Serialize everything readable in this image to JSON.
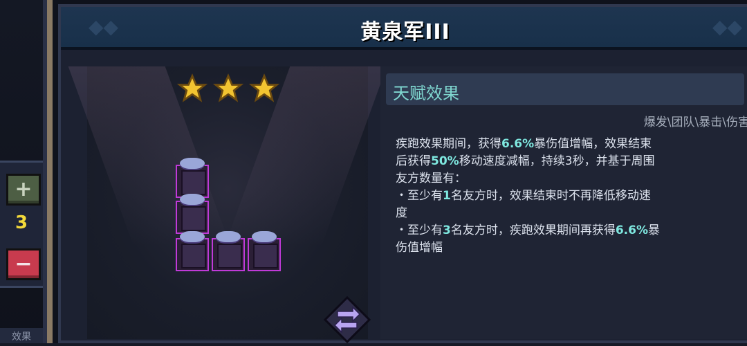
{
  "title": "黄泉军III",
  "stepper": {
    "plus": "+",
    "minus": "−",
    "count": "3"
  },
  "bottom_tab": "效果",
  "stars": {
    "rating": 3,
    "max": 3
  },
  "talent": {
    "header": "天赋效果",
    "tags": "爆发\\团队\\暴击\\伤害",
    "lines": [
      [
        {
          "t": "疾跑效果期间，获得"
        },
        {
          "t": "6.6%",
          "hl": true
        },
        {
          "t": "暴伤值增幅，效果结束"
        }
      ],
      [
        {
          "t": "后获得"
        },
        {
          "t": "50%",
          "hl": true
        },
        {
          "t": "移动速度减幅，持续3秒，并基于周围"
        }
      ],
      [
        {
          "t": "友方数量有："
        }
      ],
      [
        {
          "t": "・至少有"
        },
        {
          "t": "1",
          "hl": true
        },
        {
          "t": "名友方时，效果结束时不再降低移动速"
        }
      ],
      [
        {
          "t": "度"
        }
      ],
      [
        {
          "t": "・至少有"
        },
        {
          "t": "3",
          "hl": true
        },
        {
          "t": "名友方时，疾跑效果期间再获得"
        },
        {
          "t": "6.6%",
          "hl": true
        },
        {
          "t": "暴"
        }
      ],
      [
        {
          "t": "伤值增幅"
        }
      ]
    ]
  },
  "colors": {
    "highlight": "#7fe8e0",
    "piece_border": "#c03ad8",
    "star": "#f2c431"
  },
  "icons": [
    "plus-icon",
    "minus-icon",
    "star-icon",
    "swap-icon"
  ]
}
